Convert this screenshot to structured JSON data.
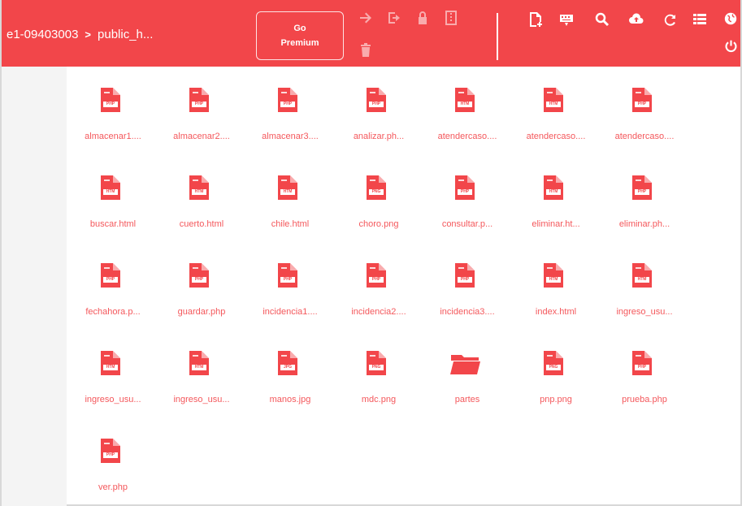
{
  "header": {
    "breadcrumb": [
      "e1-09403003",
      "public_h..."
    ],
    "separator": ">",
    "go_premium": {
      "line1": "Go",
      "line2": "Premium"
    }
  },
  "toolbar_icons": [
    "arrow-right-icon",
    "logout-icon",
    "lock-icon",
    "compress-icon",
    "trash-icon",
    "add-file-icon",
    "keyboard-icon",
    "search-icon",
    "cloud-upload-icon",
    "refresh-icon",
    "list-view-icon",
    "globe-icon",
    "power-icon"
  ],
  "colors": {
    "accent": "#f2464a",
    "label": "#f4585c",
    "sidebar": "#f4f4f4"
  },
  "files": [
    {
      "name": "almacenar1....",
      "type": "PHP"
    },
    {
      "name": "almacenar2....",
      "type": "PHP"
    },
    {
      "name": "almacenar3....",
      "type": "PHP"
    },
    {
      "name": "analizar.ph...",
      "type": "PHP"
    },
    {
      "name": "atendercaso....",
      "type": "HTM"
    },
    {
      "name": "atendercaso....",
      "type": "HTM"
    },
    {
      "name": "atendercaso....",
      "type": "PHP"
    },
    {
      "name": "buscar.html",
      "type": "HTM"
    },
    {
      "name": "cuerto.html",
      "type": "HTM"
    },
    {
      "name": "chile.html",
      "type": "HTM"
    },
    {
      "name": "choro.png",
      "type": "PNG"
    },
    {
      "name": "consultar.p...",
      "type": "PHP"
    },
    {
      "name": "eliminar.ht...",
      "type": "HTM"
    },
    {
      "name": "eliminar.ph...",
      "type": "PHP"
    },
    {
      "name": "fechahora.p...",
      "type": "PHP"
    },
    {
      "name": "guardar.php",
      "type": "PHP"
    },
    {
      "name": "incidencia1....",
      "type": "PHP"
    },
    {
      "name": "incidencia2....",
      "type": "PHP"
    },
    {
      "name": "incidencia3....",
      "type": "PHP"
    },
    {
      "name": "index.html",
      "type": "HTM"
    },
    {
      "name": "ingreso_usu...",
      "type": "HTM"
    },
    {
      "name": "ingreso_usu...",
      "type": "HTM"
    },
    {
      "name": "ingreso_usu...",
      "type": "HTM"
    },
    {
      "name": "manos.jpg",
      "type": "JPG"
    },
    {
      "name": "mdc.png",
      "type": "PNG"
    },
    {
      "name": "partes",
      "type": "folder"
    },
    {
      "name": "pnp.png",
      "type": "PNG"
    },
    {
      "name": "prueba.php",
      "type": "PHP"
    },
    {
      "name": "ver.php",
      "type": "PHP"
    }
  ]
}
